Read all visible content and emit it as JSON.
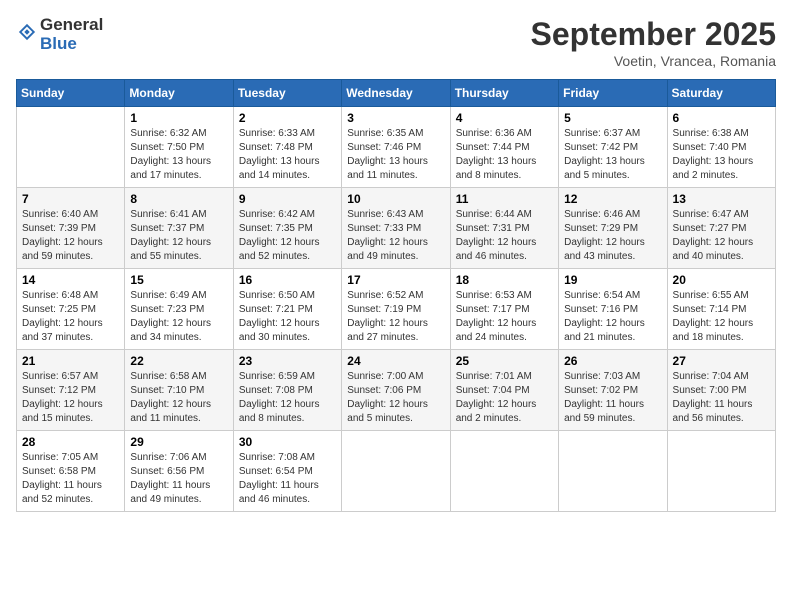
{
  "header": {
    "logo_line1": "General",
    "logo_line2": "Blue",
    "month": "September 2025",
    "location": "Voetin, Vrancea, Romania"
  },
  "days_of_week": [
    "Sunday",
    "Monday",
    "Tuesday",
    "Wednesday",
    "Thursday",
    "Friday",
    "Saturday"
  ],
  "weeks": [
    [
      {
        "num": "",
        "info": ""
      },
      {
        "num": "1",
        "info": "Sunrise: 6:32 AM\nSunset: 7:50 PM\nDaylight: 13 hours\nand 17 minutes."
      },
      {
        "num": "2",
        "info": "Sunrise: 6:33 AM\nSunset: 7:48 PM\nDaylight: 13 hours\nand 14 minutes."
      },
      {
        "num": "3",
        "info": "Sunrise: 6:35 AM\nSunset: 7:46 PM\nDaylight: 13 hours\nand 11 minutes."
      },
      {
        "num": "4",
        "info": "Sunrise: 6:36 AM\nSunset: 7:44 PM\nDaylight: 13 hours\nand 8 minutes."
      },
      {
        "num": "5",
        "info": "Sunrise: 6:37 AM\nSunset: 7:42 PM\nDaylight: 13 hours\nand 5 minutes."
      },
      {
        "num": "6",
        "info": "Sunrise: 6:38 AM\nSunset: 7:40 PM\nDaylight: 13 hours\nand 2 minutes."
      }
    ],
    [
      {
        "num": "7",
        "info": "Sunrise: 6:40 AM\nSunset: 7:39 PM\nDaylight: 12 hours\nand 59 minutes."
      },
      {
        "num": "8",
        "info": "Sunrise: 6:41 AM\nSunset: 7:37 PM\nDaylight: 12 hours\nand 55 minutes."
      },
      {
        "num": "9",
        "info": "Sunrise: 6:42 AM\nSunset: 7:35 PM\nDaylight: 12 hours\nand 52 minutes."
      },
      {
        "num": "10",
        "info": "Sunrise: 6:43 AM\nSunset: 7:33 PM\nDaylight: 12 hours\nand 49 minutes."
      },
      {
        "num": "11",
        "info": "Sunrise: 6:44 AM\nSunset: 7:31 PM\nDaylight: 12 hours\nand 46 minutes."
      },
      {
        "num": "12",
        "info": "Sunrise: 6:46 AM\nSunset: 7:29 PM\nDaylight: 12 hours\nand 43 minutes."
      },
      {
        "num": "13",
        "info": "Sunrise: 6:47 AM\nSunset: 7:27 PM\nDaylight: 12 hours\nand 40 minutes."
      }
    ],
    [
      {
        "num": "14",
        "info": "Sunrise: 6:48 AM\nSunset: 7:25 PM\nDaylight: 12 hours\nand 37 minutes."
      },
      {
        "num": "15",
        "info": "Sunrise: 6:49 AM\nSunset: 7:23 PM\nDaylight: 12 hours\nand 34 minutes."
      },
      {
        "num": "16",
        "info": "Sunrise: 6:50 AM\nSunset: 7:21 PM\nDaylight: 12 hours\nand 30 minutes."
      },
      {
        "num": "17",
        "info": "Sunrise: 6:52 AM\nSunset: 7:19 PM\nDaylight: 12 hours\nand 27 minutes."
      },
      {
        "num": "18",
        "info": "Sunrise: 6:53 AM\nSunset: 7:17 PM\nDaylight: 12 hours\nand 24 minutes."
      },
      {
        "num": "19",
        "info": "Sunrise: 6:54 AM\nSunset: 7:16 PM\nDaylight: 12 hours\nand 21 minutes."
      },
      {
        "num": "20",
        "info": "Sunrise: 6:55 AM\nSunset: 7:14 PM\nDaylight: 12 hours\nand 18 minutes."
      }
    ],
    [
      {
        "num": "21",
        "info": "Sunrise: 6:57 AM\nSunset: 7:12 PM\nDaylight: 12 hours\nand 15 minutes."
      },
      {
        "num": "22",
        "info": "Sunrise: 6:58 AM\nSunset: 7:10 PM\nDaylight: 12 hours\nand 11 minutes."
      },
      {
        "num": "23",
        "info": "Sunrise: 6:59 AM\nSunset: 7:08 PM\nDaylight: 12 hours\nand 8 minutes."
      },
      {
        "num": "24",
        "info": "Sunrise: 7:00 AM\nSunset: 7:06 PM\nDaylight: 12 hours\nand 5 minutes."
      },
      {
        "num": "25",
        "info": "Sunrise: 7:01 AM\nSunset: 7:04 PM\nDaylight: 12 hours\nand 2 minutes."
      },
      {
        "num": "26",
        "info": "Sunrise: 7:03 AM\nSunset: 7:02 PM\nDaylight: 11 hours\nand 59 minutes."
      },
      {
        "num": "27",
        "info": "Sunrise: 7:04 AM\nSunset: 7:00 PM\nDaylight: 11 hours\nand 56 minutes."
      }
    ],
    [
      {
        "num": "28",
        "info": "Sunrise: 7:05 AM\nSunset: 6:58 PM\nDaylight: 11 hours\nand 52 minutes."
      },
      {
        "num": "29",
        "info": "Sunrise: 7:06 AM\nSunset: 6:56 PM\nDaylight: 11 hours\nand 49 minutes."
      },
      {
        "num": "30",
        "info": "Sunrise: 7:08 AM\nSunset: 6:54 PM\nDaylight: 11 hours\nand 46 minutes."
      },
      {
        "num": "",
        "info": ""
      },
      {
        "num": "",
        "info": ""
      },
      {
        "num": "",
        "info": ""
      },
      {
        "num": "",
        "info": ""
      }
    ]
  ]
}
